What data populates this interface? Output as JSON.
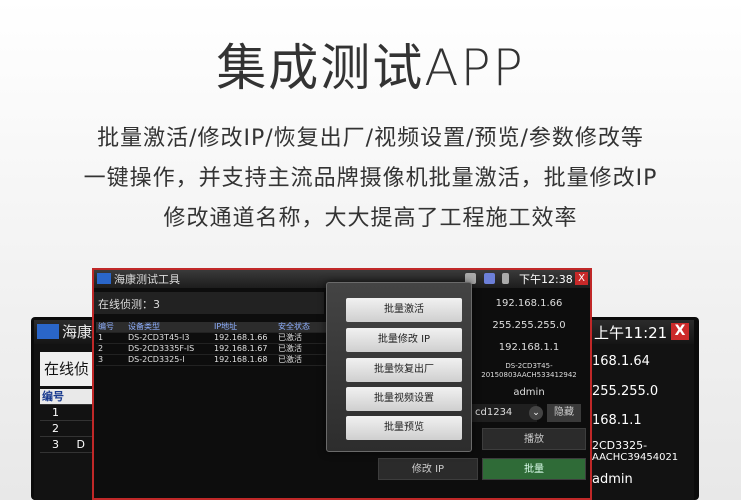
{
  "headline": "集成测试APP",
  "description": [
    "批量激活/修改IP/恢复出厂/视频设置/预览/参数修改等",
    "一键操作，并支持主流品牌摄像机批量激活，批量修改IP",
    "修改通道名称，大大提高了工程施工效率"
  ],
  "back_device": {
    "title": "海康",
    "time": "上午11:21",
    "close_label": "X",
    "online_label": "在线侦",
    "table_header": "编号",
    "rows": [
      "1",
      "2",
      "3"
    ],
    "row_suffix_3": "D",
    "right_values": [
      "168.1.64",
      "255.255.0",
      "168.1.1",
      "2CD3325-",
      "AACHC39454021",
      "admin"
    ]
  },
  "front_device": {
    "title": "海康测试工具",
    "time": "下午12:38",
    "close_label": "X",
    "online_label": "在线侦测：3",
    "table": {
      "headers": [
        "编号",
        "设备类型",
        "IP地址",
        "安全状态"
      ],
      "rows": [
        [
          "1",
          "DS-2CD3T45-I3",
          "192.168.1.66",
          "已激活"
        ],
        [
          "2",
          "DS-2CD3335F-IS",
          "192.168.1.67",
          "已激活"
        ],
        [
          "3",
          "DS-2CD3325-I",
          "192.168.1.68",
          "已激活"
        ]
      ]
    },
    "right_panel": {
      "ip": "192.168.1.66",
      "mask": "255.255.255.0",
      "gateway": "192.168.1.1",
      "serial_line1": "DS-2CD3T45-",
      "serial_line2": "20150803AACH533412942",
      "user": "admin",
      "password": "cd1234",
      "password_toggle": "隐藏"
    },
    "buttons": {
      "play": "播放",
      "modify_ip": "修改 IP",
      "batch": "批量"
    }
  },
  "menu": {
    "items": [
      "批量激活",
      "批量修改 IP",
      "批量恢复出厂",
      "批量视频设置",
      "批量预览"
    ]
  }
}
